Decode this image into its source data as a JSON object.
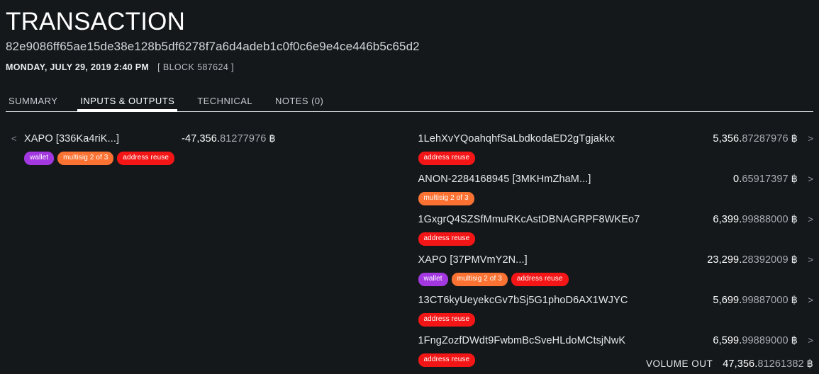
{
  "header": {
    "title": "TRANSACTION",
    "hash": "82e9086ff65ae15de38e128b5df6278f7a6d4adeb1c0f0c6e9e4ce446b5c65d2",
    "date": "MONDAY, JULY 29, 2019 2:40 PM",
    "block": "[ BLOCK 587624 ]"
  },
  "tabs": [
    {
      "label": "SUMMARY",
      "active": false
    },
    {
      "label": "INPUTS & OUTPUTS",
      "active": true
    },
    {
      "label": "TECHNICAL",
      "active": false
    },
    {
      "label": "NOTES (0)",
      "active": false
    }
  ],
  "symbol": "฿",
  "in_chevron": "<",
  "out_chevron": ">",
  "inputs": [
    {
      "address": "XAPO [336Ka4riK...]",
      "amount_int": "-47,356.",
      "amount_dec": "81277976",
      "tags": [
        "wallet",
        "multisig 2 of 3",
        "address reuse"
      ]
    }
  ],
  "outputs": [
    {
      "address": "1LehXvYQoahqhfSaLbdkodaED2gTgjakkx",
      "amount_int": "5,356.",
      "amount_dec": "87287976",
      "tags": [
        "address reuse"
      ]
    },
    {
      "address": "ANON-2284168945 [3MKHmZhaM...]",
      "amount_int": "0.",
      "amount_dec": "65917397",
      "tags": [
        "multisig 2 of 3"
      ]
    },
    {
      "address": "1GxgrQ4SZSfMmuRKcAstDBNAGRPF8WKEo7",
      "amount_int": "6,399.",
      "amount_dec": "99888000",
      "tags": [
        "address reuse"
      ]
    },
    {
      "address": "XAPO [37PMVmY2N...]",
      "amount_int": "23,299.",
      "amount_dec": "28392009",
      "tags": [
        "wallet",
        "multisig 2 of 3",
        "address reuse"
      ]
    },
    {
      "address": "13CT6kyUeyekcGv7bSj5G1phoD6AX1WJYC",
      "amount_int": "5,699.",
      "amount_dec": "99887000",
      "tags": [
        "address reuse"
      ]
    },
    {
      "address": "1FngZozfDWdt9FwbmBcSveHLdoMCtsjNwK",
      "amount_int": "6,599.",
      "amount_dec": "99889000",
      "tags": [
        "address reuse"
      ]
    }
  ],
  "footer": {
    "volume_label": "VOLUME OUT",
    "volume_int": "47,356.",
    "volume_dec": "81261382"
  },
  "colors": {
    "background": "#14181b",
    "tag_wallet": "#a438e0",
    "tag_multisig": "#fb7232",
    "tag_reuse": "#f41616",
    "accent": "#ffffff"
  }
}
